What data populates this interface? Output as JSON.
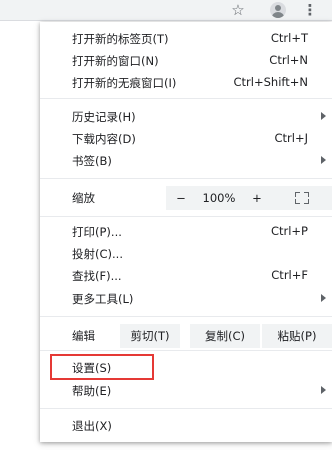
{
  "toolbar": {
    "star_icon": "☆",
    "avatar_icon": "account-circle",
    "more_icon": "⋮"
  },
  "menu": {
    "new_tab": {
      "label": "打开新的标签页(T)",
      "shortcut": "Ctrl+T"
    },
    "new_window": {
      "label": "打开新的窗口(N)",
      "shortcut": "Ctrl+N"
    },
    "new_incognito": {
      "label": "打开新的无痕窗口(I)",
      "shortcut": "Ctrl+Shift+N"
    },
    "history": {
      "label": "历史记录(H)"
    },
    "downloads": {
      "label": "下载内容(D)",
      "shortcut": "Ctrl+J"
    },
    "bookmarks": {
      "label": "书签(B)"
    },
    "zoom": {
      "label": "缩放",
      "minus": "−",
      "value": "100%",
      "plus": "+"
    },
    "print": {
      "label": "打印(P)...",
      "shortcut": "Ctrl+P"
    },
    "cast": {
      "label": "投射(C)..."
    },
    "find": {
      "label": "查找(F)...",
      "shortcut": "Ctrl+F"
    },
    "more_tools": {
      "label": "更多工具(L)"
    },
    "edit": {
      "label": "编辑",
      "cut": "剪切(T)",
      "copy": "复制(C)",
      "paste": "粘贴(P)"
    },
    "settings": {
      "label": "设置(S)"
    },
    "help": {
      "label": "帮助(E)"
    },
    "exit": {
      "label": "退出(X)"
    }
  },
  "colors": {
    "highlight_border": "#e53935",
    "menu_bg": "#ffffff",
    "button_bg": "#f1f3f4"
  }
}
